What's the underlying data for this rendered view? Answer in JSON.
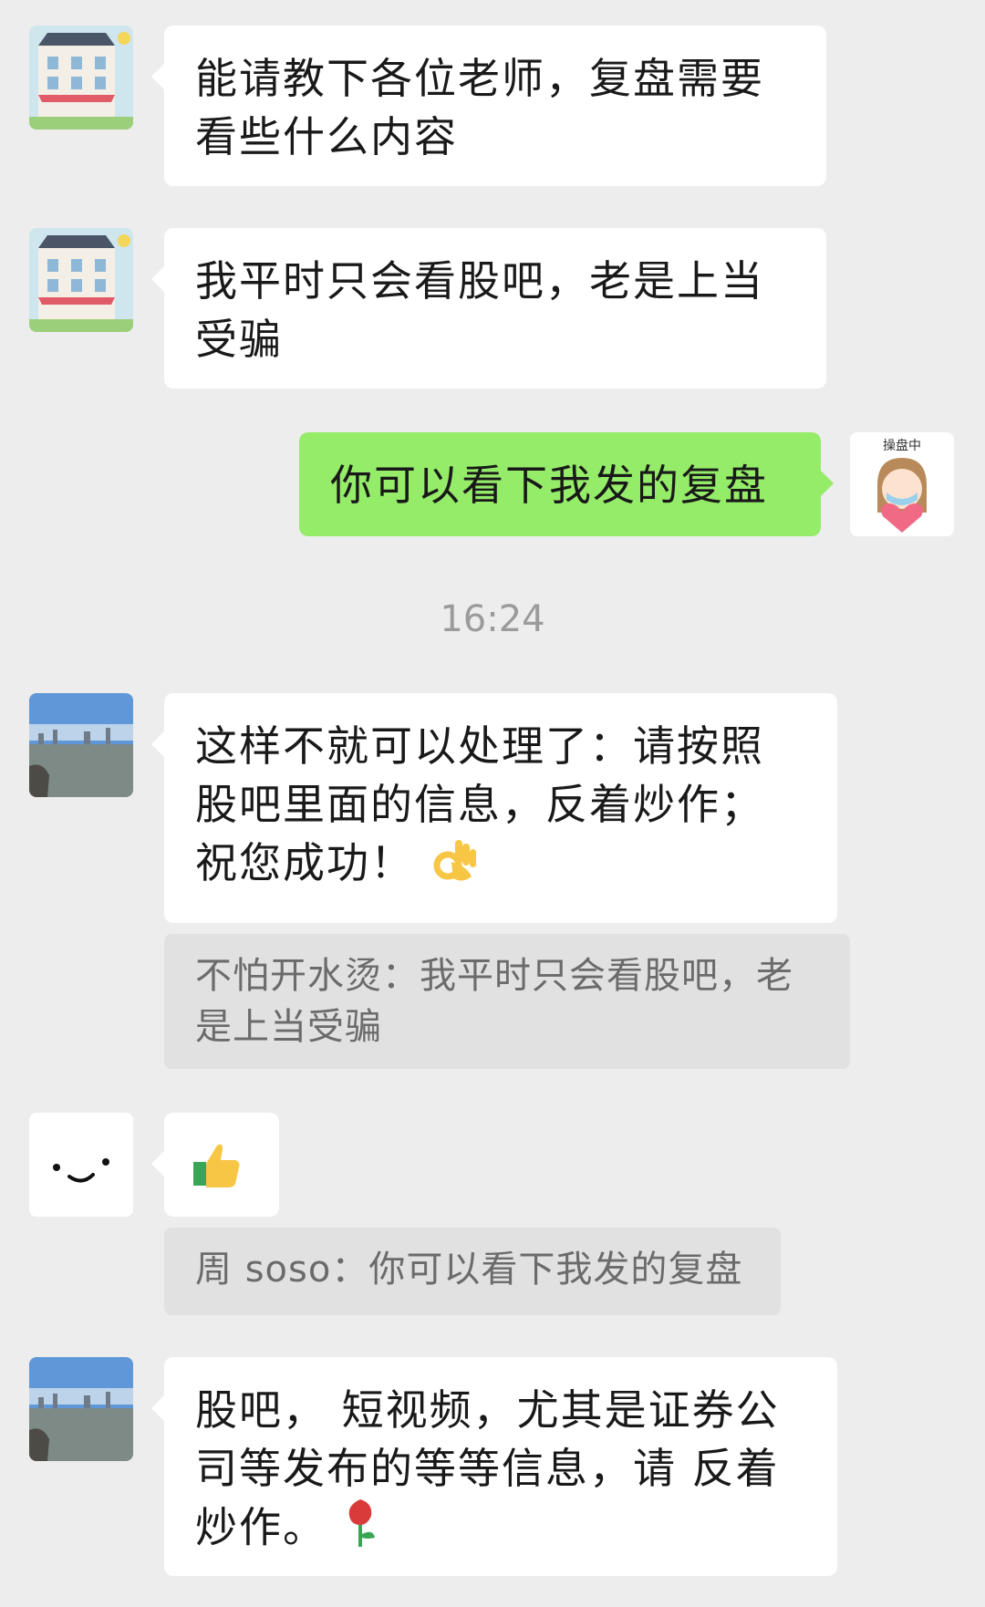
{
  "colors": {
    "background": "#ededed",
    "bubble_incoming": "#ffffff",
    "bubble_outgoing": "#95ec69",
    "quote_bg": "#e1e1e1"
  },
  "messages": [
    {
      "text": "能请教下各位老师，复盘需要看些什么内容"
    },
    {
      "text": "我平时只会看股吧，老是上当受骗"
    },
    {
      "text": "你可以看下我发的复盘",
      "avatar_caption": "操盘中"
    },
    {
      "text": "这样不就可以处理了：请按照股吧里面的信息，反着炒作；祝您成功！",
      "emoji": "ok-hand"
    },
    {
      "quote": "不怕开水烫：我平时只会看股吧，老是上当受骗"
    },
    {
      "emoji": "thumbs-up"
    },
    {
      "quote": "周 soso：你可以看下我发的复盘"
    },
    {
      "text": "股吧， 短视频，尤其是证券公司等发布的等等信息，请 反着炒作。",
      "emoji": "rose"
    }
  ],
  "timestamp": "16:24"
}
